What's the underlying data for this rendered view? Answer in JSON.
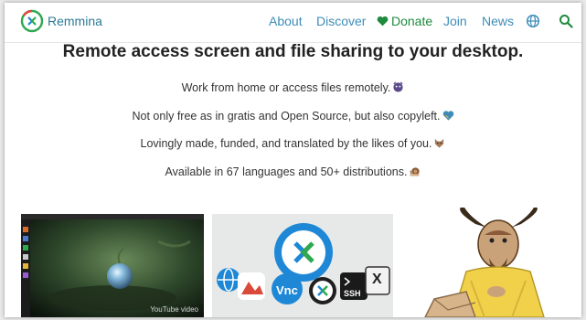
{
  "header": {
    "brand": "Remmina",
    "nav": {
      "about": "About",
      "discover": "Discover",
      "donate": "Donate",
      "join": "Join",
      "news": "News"
    },
    "icons": [
      "remmina-logo-icon",
      "heart-icon",
      "globe-icon",
      "search-icon"
    ]
  },
  "main": {
    "headline": "Remote access screen and file sharing to your desktop.",
    "features": [
      "Work from home or access files remotely.",
      "Not only free as in gratis and Open Source, but also copyleft.",
      "Lovingly made, funded, and translated by the likes of you.",
      "Available in 67 languages and 50+ distributions."
    ],
    "video_caption": "YouTube video",
    "protocol_labels": {
      "vnc": "Vnc",
      "ssh": "SSH",
      "x": "X"
    }
  },
  "colors": {
    "nav_link": "#3d8db8",
    "donate": "#1e8a3e",
    "brand": "#2b7a95",
    "remmina_blue": "#1e88d6",
    "remmina_green": "#2fa84f"
  }
}
